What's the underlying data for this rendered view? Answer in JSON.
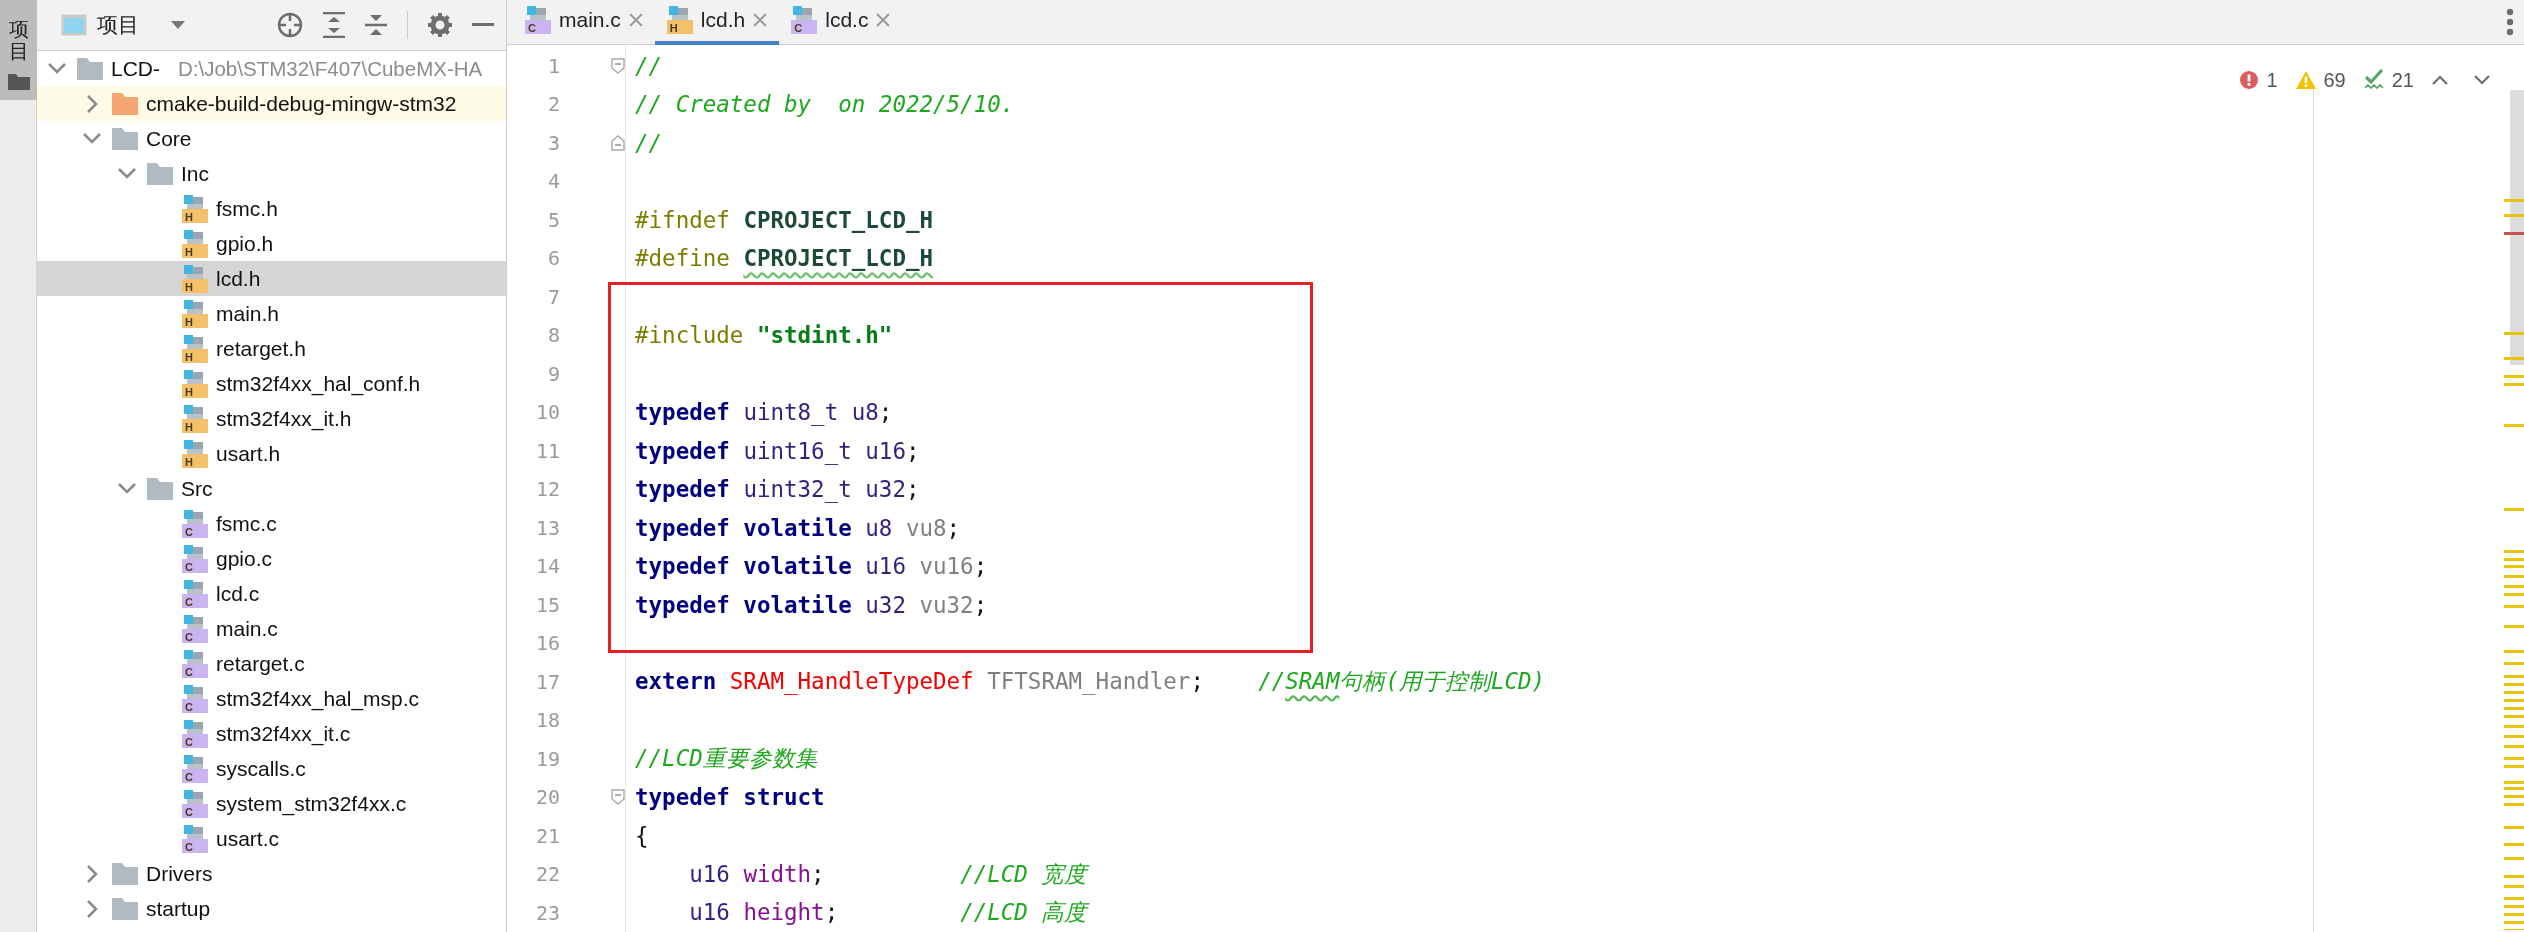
{
  "side_strip": {
    "tabs": [
      {
        "label": "项目",
        "selected": true
      }
    ]
  },
  "project_panel": {
    "title": "项目",
    "tree": [
      {
        "name": "LCD-",
        "path": "D:\\Job\\STM32\\F407\\CubeMX-HA",
        "kind": "folder",
        "expanded": true,
        "selected": false,
        "children": [
          {
            "name": "cmake-build-debug-mingw-stm32",
            "kind": "excluded-folder",
            "expanded": false,
            "selected": false
          },
          {
            "name": "Core",
            "kind": "folder",
            "expanded": true,
            "selected": false,
            "children": [
              {
                "name": "Inc",
                "kind": "folder",
                "expanded": true,
                "selected": false,
                "children": [
                  {
                    "name": "fsmc.h",
                    "kind": "header",
                    "badge": "H",
                    "selected": false
                  },
                  {
                    "name": "gpio.h",
                    "kind": "header",
                    "badge": "H",
                    "selected": false
                  },
                  {
                    "name": "lcd.h",
                    "kind": "header",
                    "badge": "H",
                    "selected": true
                  },
                  {
                    "name": "main.h",
                    "kind": "header",
                    "badge": "H",
                    "selected": false
                  },
                  {
                    "name": "retarget.h",
                    "kind": "header",
                    "badge": "H",
                    "selected": false
                  },
                  {
                    "name": "stm32f4xx_hal_conf.h",
                    "kind": "header",
                    "badge": "H",
                    "selected": false
                  },
                  {
                    "name": "stm32f4xx_it.h",
                    "kind": "header",
                    "badge": "H",
                    "selected": false
                  },
                  {
                    "name": "usart.h",
                    "kind": "header",
                    "badge": "H",
                    "selected": false
                  }
                ]
              },
              {
                "name": "Src",
                "kind": "folder",
                "expanded": true,
                "selected": false,
                "children": [
                  {
                    "name": "fsmc.c",
                    "kind": "source",
                    "badge": "C",
                    "selected": false
                  },
                  {
                    "name": "gpio.c",
                    "kind": "source",
                    "badge": "C",
                    "selected": false
                  },
                  {
                    "name": "lcd.c",
                    "kind": "source",
                    "badge": "C",
                    "selected": false
                  },
                  {
                    "name": "main.c",
                    "kind": "source",
                    "badge": "C",
                    "selected": false
                  },
                  {
                    "name": "retarget.c",
                    "kind": "source",
                    "badge": "C",
                    "selected": false
                  },
                  {
                    "name": "stm32f4xx_hal_msp.c",
                    "kind": "source",
                    "badge": "C",
                    "selected": false
                  },
                  {
                    "name": "stm32f4xx_it.c",
                    "kind": "source",
                    "badge": "C",
                    "selected": false
                  },
                  {
                    "name": "syscalls.c",
                    "kind": "source",
                    "badge": "C",
                    "selected": false
                  },
                  {
                    "name": "system_stm32f4xx.c",
                    "kind": "source",
                    "badge": "C",
                    "selected": false
                  },
                  {
                    "name": "usart.c",
                    "kind": "source",
                    "badge": "C",
                    "selected": false
                  }
                ]
              }
            ]
          },
          {
            "name": "Drivers",
            "kind": "folder",
            "expanded": false,
            "selected": false
          },
          {
            "name": "startup",
            "kind": "folder",
            "expanded": false,
            "selected": false
          }
        ]
      }
    ]
  },
  "editor": {
    "tabs": [
      {
        "label": "main.c",
        "kind": "source",
        "badge": "C",
        "selected": false
      },
      {
        "label": "lcd.h",
        "kind": "header",
        "badge": "H",
        "selected": true
      },
      {
        "label": "lcd.c",
        "kind": "source",
        "badge": "C",
        "selected": false
      }
    ],
    "inspections": {
      "errors": "1",
      "warnings": "69",
      "typos": "21"
    },
    "blocks": [
      {
        "boxed": false,
        "lines": [
          {
            "number": "1",
            "kind": "fold-start",
            "tokens": [
              {
                "t": "//",
                "kind": "comment"
              }
            ]
          },
          {
            "number": "2",
            "kind": "plain",
            "tokens": [
              {
                "t": "// Created by  on 2022/5/10.",
                "kind": "comment"
              }
            ]
          },
          {
            "number": "3",
            "kind": "fold-end",
            "tokens": [
              {
                "t": "//",
                "kind": "comment"
              }
            ]
          },
          {
            "number": "4",
            "kind": "plain"
          },
          {
            "number": "5",
            "kind": "plain",
            "tokens": [
              {
                "t": "#ifndef ",
                "kind": "preproc"
              },
              {
                "t": "CPROJECT_LCD_H",
                "kind": "macro"
              }
            ]
          },
          {
            "number": "6",
            "kind": "plain",
            "tokens": [
              {
                "t": "#define ",
                "kind": "preproc"
              },
              {
                "t": "CPROJECT_LCD_H",
                "kind": "macro-typo"
              }
            ]
          }
        ]
      },
      {
        "boxed": true,
        "lines": [
          {
            "number": "7",
            "kind": "plain"
          },
          {
            "number": "8",
            "kind": "plain",
            "tokens": [
              {
                "t": "#include ",
                "kind": "preproc"
              },
              {
                "t": "\"stdint.h\"",
                "kind": "string"
              }
            ]
          },
          {
            "number": "9",
            "kind": "plain"
          },
          {
            "number": "10",
            "kind": "plain",
            "tokens": [
              {
                "t": "typedef ",
                "kind": "keyword"
              },
              {
                "t": "uint8_t u8",
                "kind": "type"
              },
              {
                "t": ";",
                "kind": "punct"
              }
            ]
          },
          {
            "number": "11",
            "kind": "plain",
            "tokens": [
              {
                "t": "typedef ",
                "kind": "keyword"
              },
              {
                "t": "uint16_t u16",
                "kind": "type"
              },
              {
                "t": ";",
                "kind": "punct"
              }
            ]
          },
          {
            "number": "12",
            "kind": "plain",
            "tokens": [
              {
                "t": "typedef ",
                "kind": "keyword"
              },
              {
                "t": "uint32_t u32",
                "kind": "type"
              },
              {
                "t": ";",
                "kind": "punct"
              }
            ]
          },
          {
            "number": "13",
            "kind": "plain",
            "tokens": [
              {
                "t": "typedef volatile ",
                "kind": "keyword"
              },
              {
                "t": "u8 ",
                "kind": "type"
              },
              {
                "t": "vu8",
                "kind": "unused"
              },
              {
                "t": ";",
                "kind": "punct"
              }
            ]
          },
          {
            "number": "14",
            "kind": "plain",
            "tokens": [
              {
                "t": "typedef volatile ",
                "kind": "keyword"
              },
              {
                "t": "u16 ",
                "kind": "type"
              },
              {
                "t": "vu16",
                "kind": "unused"
              },
              {
                "t": ";",
                "kind": "punct"
              }
            ]
          },
          {
            "number": "15",
            "kind": "plain",
            "tokens": [
              {
                "t": "typedef volatile ",
                "kind": "keyword"
              },
              {
                "t": "u32 ",
                "kind": "type"
              },
              {
                "t": "vu32",
                "kind": "unused"
              },
              {
                "t": ";",
                "kind": "punct"
              }
            ]
          },
          {
            "number": "16",
            "kind": "plain"
          }
        ]
      },
      {
        "boxed": false,
        "lines": [
          {
            "number": "17",
            "kind": "plain",
            "tokens": [
              {
                "t": "extern ",
                "kind": "keyword"
              },
              {
                "t": "SRAM_HandleTypeDef",
                "kind": "error"
              },
              {
                "t": " TFTSRAM_Handler",
                "kind": "unused"
              },
              {
                "t": ";    ",
                "kind": "punct"
              },
              {
                "t": "//",
                "kind": "comment"
              },
              {
                "t": "SRAM",
                "kind": "comment-typo"
              },
              {
                "t": "句柄(用于控制LCD)",
                "kind": "comment"
              }
            ]
          },
          {
            "number": "18",
            "kind": "plain"
          },
          {
            "number": "19",
            "kind": "plain",
            "tokens": [
              {
                "t": "//LCD重要参数集",
                "kind": "comment"
              }
            ]
          },
          {
            "number": "20",
            "kind": "fold-start",
            "tokens": [
              {
                "t": "typedef struct",
                "kind": "keyword"
              }
            ]
          },
          {
            "number": "21",
            "kind": "plain",
            "tokens": [
              {
                "t": "{",
                "kind": "punct"
              }
            ]
          },
          {
            "number": "22",
            "kind": "plain",
            "tokens": [
              {
                "t": "    u16 ",
                "kind": "type"
              },
              {
                "t": "width",
                "kind": "field"
              },
              {
                "t": ";          ",
                "kind": "punct"
              },
              {
                "t": "//LCD 宽度",
                "kind": "comment"
              }
            ]
          },
          {
            "number": "23",
            "kind": "plain",
            "tokens": [
              {
                "t": "    u16 ",
                "kind": "type"
              },
              {
                "t": "height",
                "kind": "field"
              },
              {
                "t": ";         ",
                "kind": "punct"
              },
              {
                "t": "//LCD 高度",
                "kind": "comment"
              }
            ]
          }
        ]
      }
    ]
  }
}
